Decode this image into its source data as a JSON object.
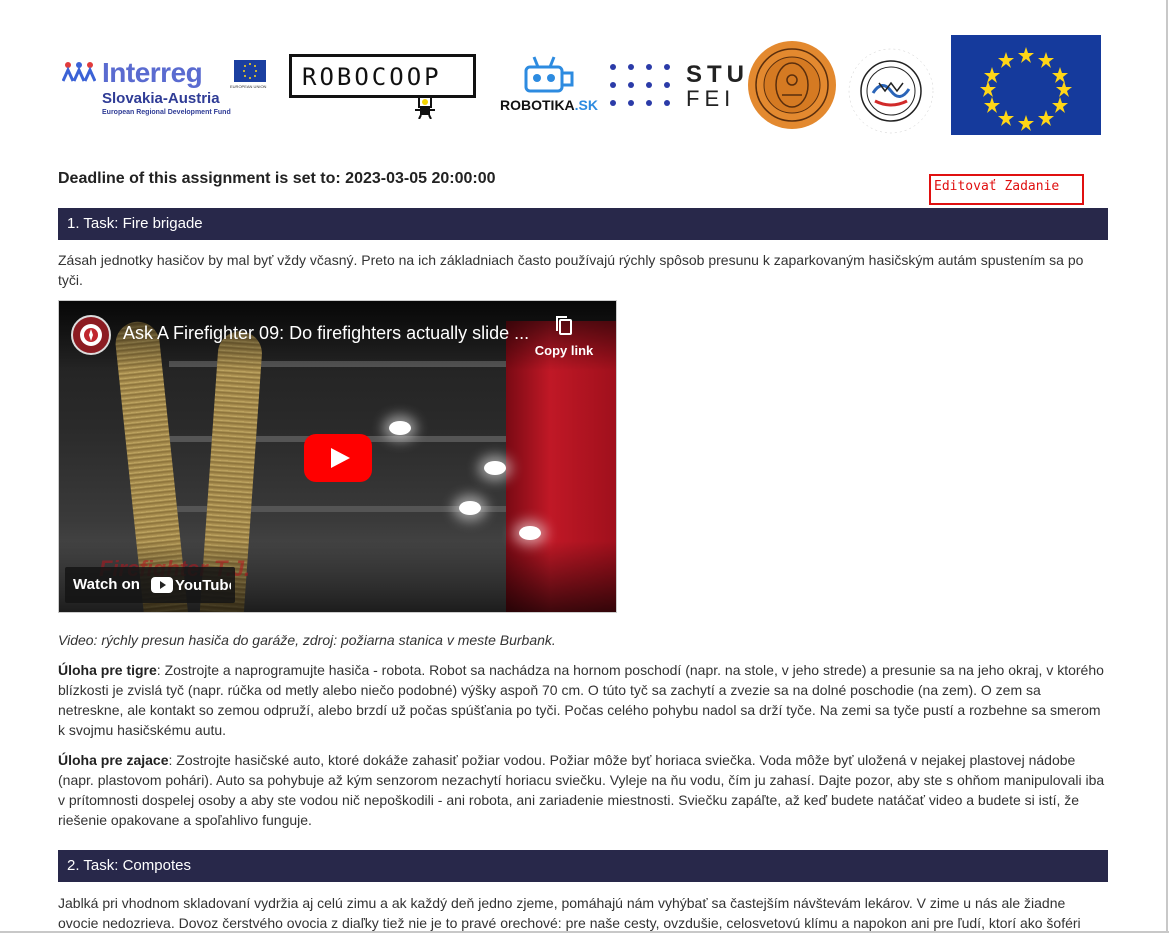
{
  "logos": {
    "interreg": {
      "name": "Interreg",
      "region": "Slovakia-Austria",
      "fund": "European Regional Development Fund",
      "flag_caption": "EUROPEAN UNION"
    },
    "robocoop": "ROBOCOOP",
    "robotika": {
      "left": "ROBOTIKA",
      "right": ".SK"
    },
    "stu": {
      "top": "STU",
      "bottom": "FEI"
    },
    "seal_icon": "comenius-university-seal-icon",
    "cvti_icon": "cvti-sr-logo-icon",
    "eu_flag_icon": "eu-flag-icon"
  },
  "deadline": "Deadline of this assignment is set to: 2023-03-05 20:00:00",
  "edit_button": "Editovať Zadanie",
  "task1": {
    "title": "1. Task: Fire brigade",
    "intro": "Zásah jednotky hasičov by mal byť vždy včasný. Preto na ich základniach často používajú rýchly spôsob presunu k zaparkovaným hasičským autám spustením sa po tyči.",
    "video": {
      "title": "Ask A Firefighter 09: Do firefighters actually slide ...",
      "copy_link": "Copy link",
      "watch_on": "Watch on",
      "youtube": "YouTube",
      "watermark": "Firefighter T.J."
    },
    "caption": "Video: rýchly presun hasiča do garáže, zdroj: požiarna stanica v meste Burbank.",
    "tiger_label": "Úloha pre tigre",
    "tiger_text": ": Zostrojte a naprogramujte hasiča - robota. Robot sa nachádza na hornom poschodí (napr. na stole, v jeho strede) a presunie sa na jeho okraj, v ktorého blízkosti je zvislá tyč (napr. rúčka od metly alebo niečo podobné) výšky aspoň 70 cm. O túto tyč sa zachytí a zvezie sa na dolné poschodie (na zem). O zem sa netreskne, ale kontakt so zemou odpruží, alebo brzdí už počas spúšťania po tyči. Počas celého pohybu nadol sa drží tyče. Na zemi sa tyče pustí a rozbehne sa smerom k svojmu hasičskému autu.",
    "rabbit_label": "Úloha pre zajace",
    "rabbit_text": ": Zostrojte hasičské auto, ktoré dokáže zahasiť požiar vodou. Požiar môže byť horiaca sviečka. Voda môže byť uložená v nejakej plastovej nádobe (napr. plastovom pohári). Auto sa pohybuje až kým senzorom nezachytí horiacu sviečku. Vyleje na ňu vodu, čím ju zahasí. Dajte pozor, aby ste s ohňom manipulovali iba v prítomnosti dospelej osoby a aby ste vodou nič nepoškodili - ani robota, ani zariadenie miestnosti. Sviečku zapáľte, až keď budete natáčať video a budete si istí, že riešenie opakovane a spoľahlivo funguje."
  },
  "task2": {
    "title": "2. Task: Compotes",
    "intro": "Jablká pri vhodnom skladovaní vydržia aj celú zimu a ak každý deň jedno zjeme, pomáhajú nám vyhýbať sa častejším návštevám lekárov. V zime u nás ale žiadne ovocie nedozrieva. Dovoz čerstvého ovocia z diaľky tiež nie je to pravé orechové: pre naše cesty, ovzdušie, celosvetovú klímu a napokon ani pre ľudí, ktorí ako šoféri"
  }
}
